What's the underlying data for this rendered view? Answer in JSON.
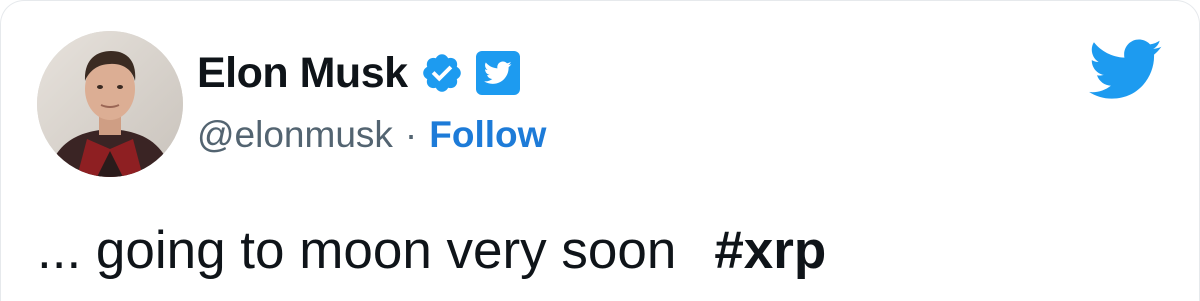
{
  "author": {
    "display_name": "Elon Musk",
    "handle": "@elonmusk",
    "separator": "·",
    "follow_label": "Follow"
  },
  "icons": {
    "verified": "verified-badge-icon",
    "twitter_badge": "twitter-badge-icon",
    "brand": "twitter-bird-icon"
  },
  "tweet": {
    "text": "... going to moon very soon",
    "hashtag": "#xrp"
  },
  "colors": {
    "twitter_blue": "#1d9bf0",
    "follow_blue": "#1d7bd8",
    "text_primary": "#0f1419",
    "text_secondary": "#536471"
  }
}
